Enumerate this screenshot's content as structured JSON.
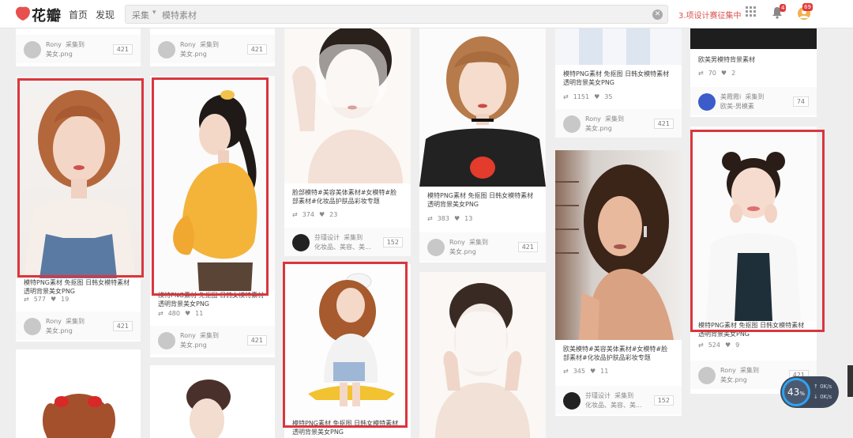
{
  "header": {
    "logo_text": "花瓣",
    "nav": [
      "首页",
      "发现"
    ],
    "search": {
      "scope": "采集",
      "query": "模特素材"
    },
    "notice": "3.项设计赛征集中",
    "badges": {
      "bell": "4",
      "user": "69"
    }
  },
  "common": {
    "user": "Rony",
    "collected": "采集到",
    "board": "美女.png",
    "count": "421"
  },
  "cards": {
    "c1": {
      "desc": "模特PNG素材 免抠图 日韩女模特素材透明背景美女PNG",
      "repins": "577",
      "likes": "19"
    },
    "c2": {
      "desc": "模特PNG素材 免抠图 日韩女模特素材透明背景美女PNG",
      "repins": "480",
      "likes": "11"
    },
    "c3": {
      "desc": "脸部模特#美容美体素材#女模特#脸部素材#化妆品护肤品彩妆专题",
      "repins": "374",
      "likes": "23",
      "user": "芬瑾设计",
      "collected": "采集到",
      "board": "化妆品、美容、美...",
      "count": "152",
      "avatar_text": "芬瑾设计"
    },
    "c4": {
      "desc": "模特PNG素材 免抠图 日韩女模特素材透明背景美女PNG",
      "repins": "383",
      "likes": "13"
    },
    "c5": {
      "desc": "模特PNG素材 免抠图 日韩女模特素材透明背景美女PNG",
      "repins": "1151",
      "likes": "35"
    },
    "c6": {
      "desc": "欧美男模特背景素材",
      "repins": "70",
      "likes": "2",
      "user": "美霞霞i",
      "collected": "采集到",
      "board": "欧美-男模素",
      "count": "74"
    },
    "c7": {
      "desc": "欧美模特#美容美体素材#女模特#脸部素材#化妆品护肤品彩妆专题",
      "repins": "345",
      "likes": "11",
      "user": "芬瑾设计",
      "collected": "采集到",
      "board": "化妆品、美容、美...",
      "count": "152",
      "avatar_text": "芬瑾设计"
    },
    "c8": {
      "desc": "模特PNG素材 免抠图 日韩女模特素材透明背景美女PNG",
      "repins": "524",
      "likes": "9"
    },
    "c9": {
      "desc": "模特PNG素材 免抠图 日韩女模特素材透明背景美女PNG"
    }
  },
  "widget": {
    "percent": "43",
    "unit": "%",
    "up": "0K/s",
    "down": "0K/s"
  },
  "colors": {
    "highlight": "#d9363e",
    "brand": "#e8504f"
  }
}
